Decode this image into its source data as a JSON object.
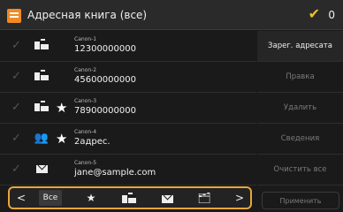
{
  "header": {
    "icon": "address-book-icon",
    "title": "Адресная книга (все)",
    "selected_count": "0"
  },
  "entries": [
    {
      "type": "fax",
      "favorite": false,
      "name": "Canon-1",
      "value": "12300000000"
    },
    {
      "type": "fax",
      "favorite": false,
      "name": "Canon-2",
      "value": "45600000000"
    },
    {
      "type": "fax",
      "favorite": true,
      "name": "Canon-3",
      "value": "78900000000"
    },
    {
      "type": "group",
      "favorite": true,
      "name": "Canon-4",
      "value": "2адрес."
    },
    {
      "type": "email",
      "favorite": false,
      "name": "Canon-5",
      "value": "jane@sample.com"
    }
  ],
  "side_buttons": {
    "register": "Зарег. адресата",
    "edit": "Правка",
    "delete": "Удалить",
    "details": "Сведения",
    "clear_all": "Очистить все"
  },
  "filter_bar": {
    "prev": "<",
    "all": "Все",
    "next": ">",
    "items": [
      "all",
      "favorite-star-icon",
      "fax-icon",
      "email-icon",
      "network-folder-icon"
    ]
  },
  "apply_label": "Применить",
  "colors": {
    "accent": "#e8a63a",
    "check": "#e8c02c",
    "app_icon": "#f08a24"
  }
}
